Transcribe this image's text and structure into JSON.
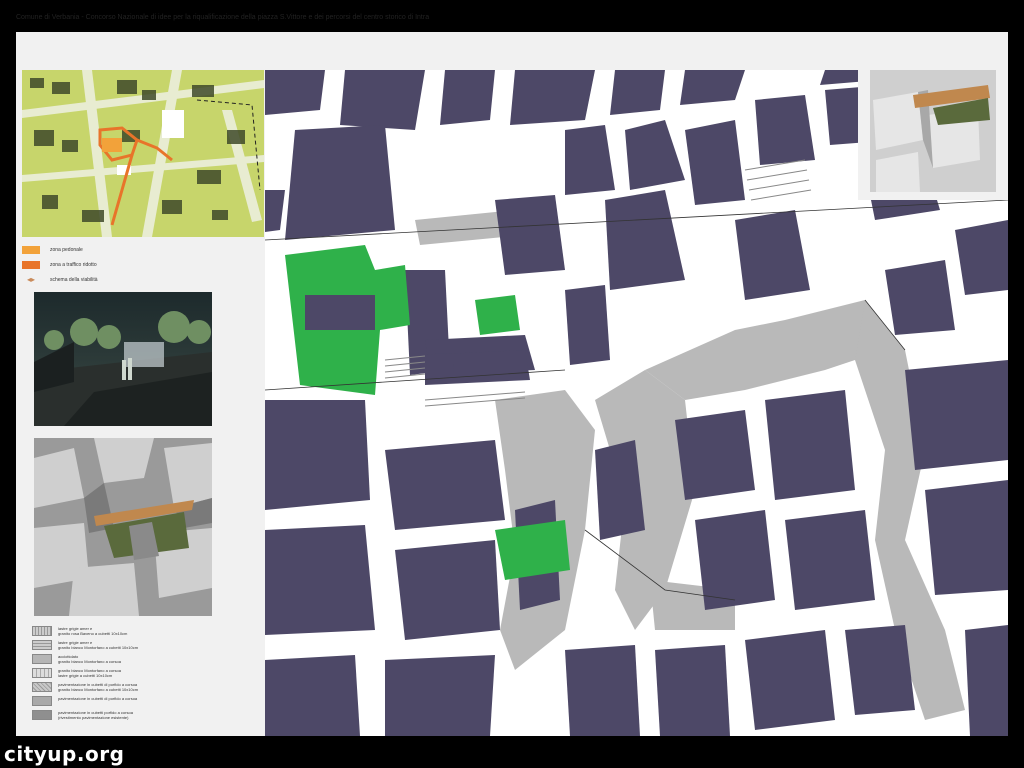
{
  "board": {
    "title": "Comune di Verbania - Concorso Nazionale di idee per la riqualificazione della piazza S.Vittore e dei percorsi del centro storico di Intra"
  },
  "legend": {
    "items": [
      {
        "label": "zona pedonale",
        "color": "#f2a23a"
      },
      {
        "label": "zona a traffico ridotto",
        "color": "#e8742a"
      },
      {
        "label": "schema della viabilità",
        "color": "#c98a5a"
      }
    ]
  },
  "materials": [
    {
      "line1": "lastre grigie amer e",
      "line2": "granito rosa Baveno a cubetti 10x10cm"
    },
    {
      "line1": "lastre grigie amer e",
      "line2": "granito bianco Montorfano a cubetti 10x10cm"
    },
    {
      "line1": "acciottolato",
      "line2": "granito bianco Montorfano a corsoa"
    },
    {
      "line1": "granito bianco Montorfano a corsoa",
      "line2": "lastre grigie a cubetti 10x10cm"
    },
    {
      "line1": "pavimentazione in cubetti di porfido a corsoa",
      "line2": "granito bianco Montorfano a cubetti 10x10cm"
    },
    {
      "line1": "pavimentazione in cubetti di porfido a corsoa",
      "line2": ""
    },
    {
      "line1": "pavimentazione in cubetti porfido a corsoa",
      "line2": "(rivestimento pavimentazione esistente)"
    }
  ],
  "colors": {
    "building": "#4d4867",
    "green": "#2fb14a",
    "paving": "#b9b9b9",
    "street": "#ffffff"
  },
  "watermark": "cityup.org"
}
